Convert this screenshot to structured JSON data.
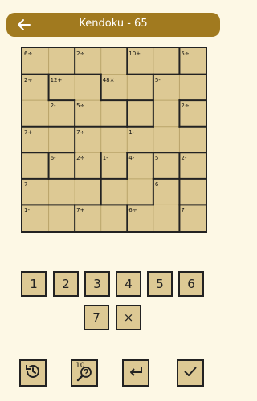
{
  "header": {
    "title": "Kendoku - 65"
  },
  "board": {
    "size": 7,
    "clues": [
      {
        "row": 0,
        "col": 0,
        "text": "6÷"
      },
      {
        "row": 0,
        "col": 2,
        "text": "2÷"
      },
      {
        "row": 0,
        "col": 4,
        "text": "10+"
      },
      {
        "row": 0,
        "col": 6,
        "text": "5÷"
      },
      {
        "row": 1,
        "col": 0,
        "text": "2÷"
      },
      {
        "row": 1,
        "col": 1,
        "text": "12+"
      },
      {
        "row": 1,
        "col": 3,
        "text": "48×"
      },
      {
        "row": 1,
        "col": 5,
        "text": "5-"
      },
      {
        "row": 2,
        "col": 1,
        "text": "2-"
      },
      {
        "row": 2,
        "col": 2,
        "text": "5÷"
      },
      {
        "row": 2,
        "col": 6,
        "text": "2÷"
      },
      {
        "row": 3,
        "col": 0,
        "text": "7+"
      },
      {
        "row": 3,
        "col": 2,
        "text": "7÷"
      },
      {
        "row": 3,
        "col": 4,
        "text": "1-"
      },
      {
        "row": 4,
        "col": 1,
        "text": "6-"
      },
      {
        "row": 4,
        "col": 2,
        "text": "2÷"
      },
      {
        "row": 4,
        "col": 3,
        "text": "1-"
      },
      {
        "row": 4,
        "col": 4,
        "text": "4-"
      },
      {
        "row": 4,
        "col": 5,
        "text": "5"
      },
      {
        "row": 4,
        "col": 6,
        "text": "2-"
      },
      {
        "row": 5,
        "col": 0,
        "text": "7"
      },
      {
        "row": 5,
        "col": 5,
        "text": "6"
      },
      {
        "row": 6,
        "col": 0,
        "text": "1-"
      },
      {
        "row": 6,
        "col": 2,
        "text": "7+"
      },
      {
        "row": 6,
        "col": 4,
        "text": "6÷"
      },
      {
        "row": 6,
        "col": 6,
        "text": "7"
      }
    ]
  },
  "keypad": {
    "keys": [
      "1",
      "2",
      "3",
      "4",
      "5",
      "6",
      "7",
      "×"
    ]
  },
  "toolbar": {
    "hint_count": "10",
    "icons": [
      "history-icon",
      "hint-icon",
      "undo-icon",
      "check-icon"
    ]
  },
  "colors": {
    "header": "#A17A1F",
    "cell": "#DDC994",
    "background": "#FDF8E5",
    "grid_line": "#222222"
  }
}
